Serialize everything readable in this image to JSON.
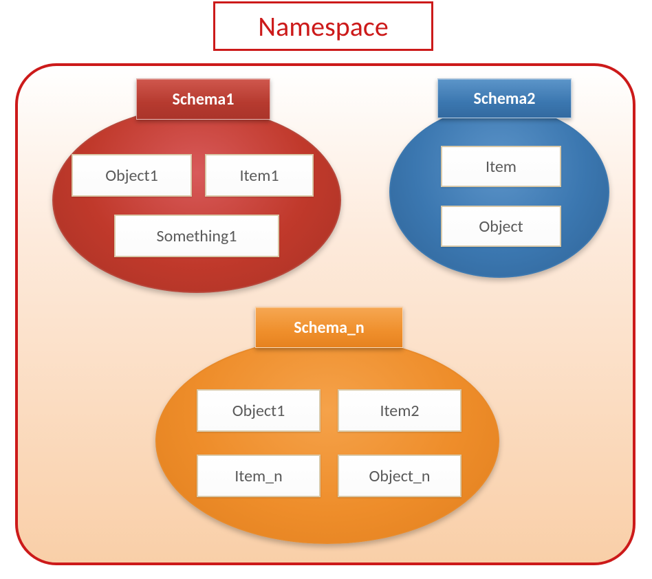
{
  "title": "Namespace",
  "schemas": {
    "schema1": {
      "label": "Schema1",
      "color": "#b63a2f",
      "objects": [
        "Object1",
        "Item1",
        "Something1"
      ]
    },
    "schema2": {
      "label": "Schema2",
      "color": "#3b77b0",
      "objects": [
        "Item",
        "Object"
      ]
    },
    "schema_n": {
      "label": "Schema_n",
      "color": "#ef8f2c",
      "objects": [
        "Object1",
        "Item2",
        "Item_n",
        "Object_n"
      ]
    }
  }
}
